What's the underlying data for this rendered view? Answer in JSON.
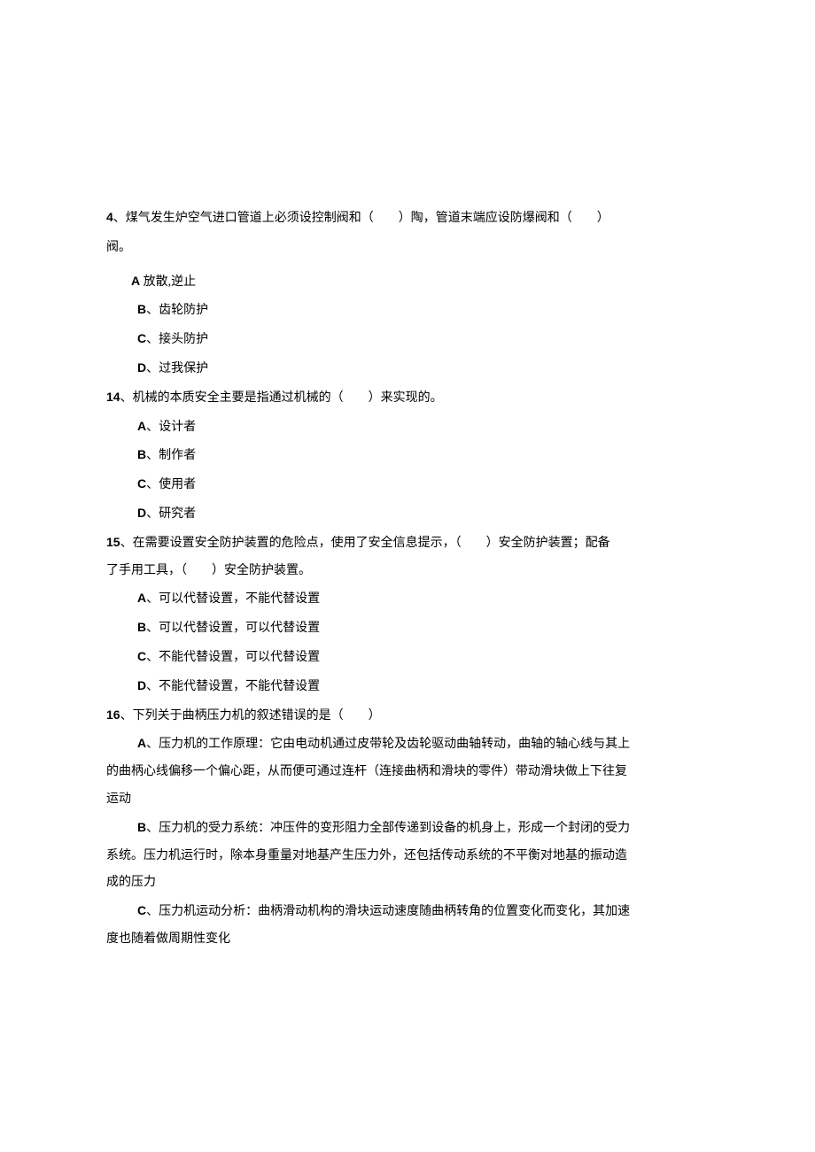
{
  "q4": {
    "num": "4",
    "stem_line1": "、煤气发生炉空气进口管道上必须设控制阀和（　　）陶，管道末端应设防爆阀和（　　）",
    "stem_line2": "阀。",
    "opt_a_label": "A",
    "opt_a_text": " 放散,逆止",
    "opt_b_label": "B",
    "opt_b_text": "、齿轮防护",
    "opt_c_label": "C",
    "opt_c_text": "、接头防护",
    "opt_d_label": "D",
    "opt_d_text": "、过我保护"
  },
  "q14": {
    "num": "14",
    "stem": "、机械的本质安全主要是指通过机械的（　　）来实现的。",
    "opt_a_label": "A",
    "opt_a_text": "、设计者",
    "opt_b_label": "B",
    "opt_b_text": "、制作者",
    "opt_c_label": "C",
    "opt_c_text": "、使用者",
    "opt_d_label": "D",
    "opt_d_text": "、研究者"
  },
  "q15": {
    "num": "15",
    "stem_line1": "、在需要设置安全防护装置的危险点，使用了安全信息提示，（　　）安全防护装置；配备",
    "stem_line2": "了手用工具，（　　）安全防护装置。",
    "opt_a_label": "A",
    "opt_a_text": "、可以代替设置，不能代替设置",
    "opt_b_label": "B",
    "opt_b_text": "、可以代替设置，可以代替设置",
    "opt_c_label": "C",
    "opt_c_text": "、不能代替设置，可以代替设置",
    "opt_d_label": "D",
    "opt_d_text": "、不能代替设置，不能代替设置"
  },
  "q16": {
    "num": "16",
    "stem": "、下列关于曲柄压力机的叙述错误的是（　　）",
    "opt_a_label": "A",
    "opt_a_line1": "、压力机的工作原理：它由电动机通过皮带轮及齿轮驱动曲轴转动，曲轴的轴心线与其上",
    "opt_a_line2": "的曲柄心线偏移一个偏心距，从而便可通过连杆（连接曲柄和滑块的零件）带动滑块做上下往复",
    "opt_a_line3": "运动",
    "opt_b_label": "B",
    "opt_b_line1": "、压力机的受力系统：冲压件的变形阻力全部传递到设备的机身上，形成一个封闭的受力",
    "opt_b_line2": "系统。压力机运行时，除本身重量对地基产生压力外，还包括传动系统的不平衡对地基的振动造",
    "opt_b_line3": "成的压力",
    "opt_c_label": "C",
    "opt_c_line1": "、压力机运动分析：曲柄滑动机构的滑块运动速度随曲柄转角的位置变化而变化，其加速",
    "opt_c_line2": "度也随着做周期性变化"
  }
}
